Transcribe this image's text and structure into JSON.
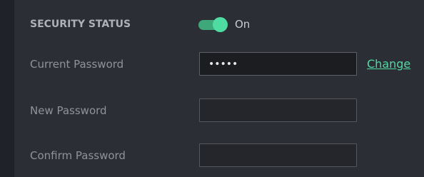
{
  "security": {
    "heading": "SECURITY STATUS",
    "toggle_state": true,
    "toggle_label": "On"
  },
  "fields": {
    "current_password": {
      "label": "Current Password",
      "value": "•••••"
    },
    "new_password": {
      "label": "New Password",
      "value": ""
    },
    "confirm_password": {
      "label": "Confirm Password",
      "value": ""
    }
  },
  "actions": {
    "change_label": "Change"
  },
  "colors": {
    "accent": "#4fdca2",
    "toggle_track": "#3ea87a",
    "background": "#2b2e35"
  }
}
